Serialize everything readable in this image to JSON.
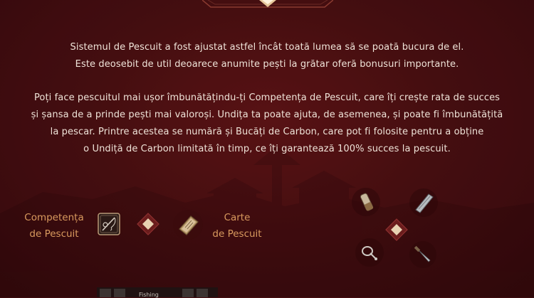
{
  "intro": {
    "line1": "Sistemul de Pescuit a fost ajustat astfel încât toată lumea să se poată bucura de el.",
    "line2": "Este deosebit de util deoarece anumite pești la grătar oferă bonusuri importante."
  },
  "details": {
    "line1": "Poți face pescuitul mai ușor îmbunătățindu-ți Competența de Pescuit, care îți crește rata de succes",
    "line2": "și șansa de a prinde pești mai valoroși. Undița ta poate ajuta, de asemenea, și poate fi îmbunătățită",
    "line3": "la pescar. Printre acestea se numără și Bucăți de Carbon, care pot fi folosite pentru a obține",
    "line4": "o Undiță de Carbon limitată în timp, ce îți garantează 100% succes la pescuit."
  },
  "skill_label": {
    "line1": "Competența",
    "line2": "de Pescuit"
  },
  "book_label": {
    "line1": "Carte",
    "line2": "de Pescuit"
  },
  "bottom_hint": "Fishing",
  "icons": {
    "skill": "fishing-skill-icon",
    "book": "fishing-book-icon",
    "items": [
      "carbon-piece-icon",
      "carbon-rod-icon",
      "fishing-hook-icon",
      "fishing-knife-icon"
    ]
  },
  "colors": {
    "background": "#4a0f12",
    "accent": "#d99a5e",
    "text": "#efe3d8",
    "gold": "#e6c79a"
  }
}
